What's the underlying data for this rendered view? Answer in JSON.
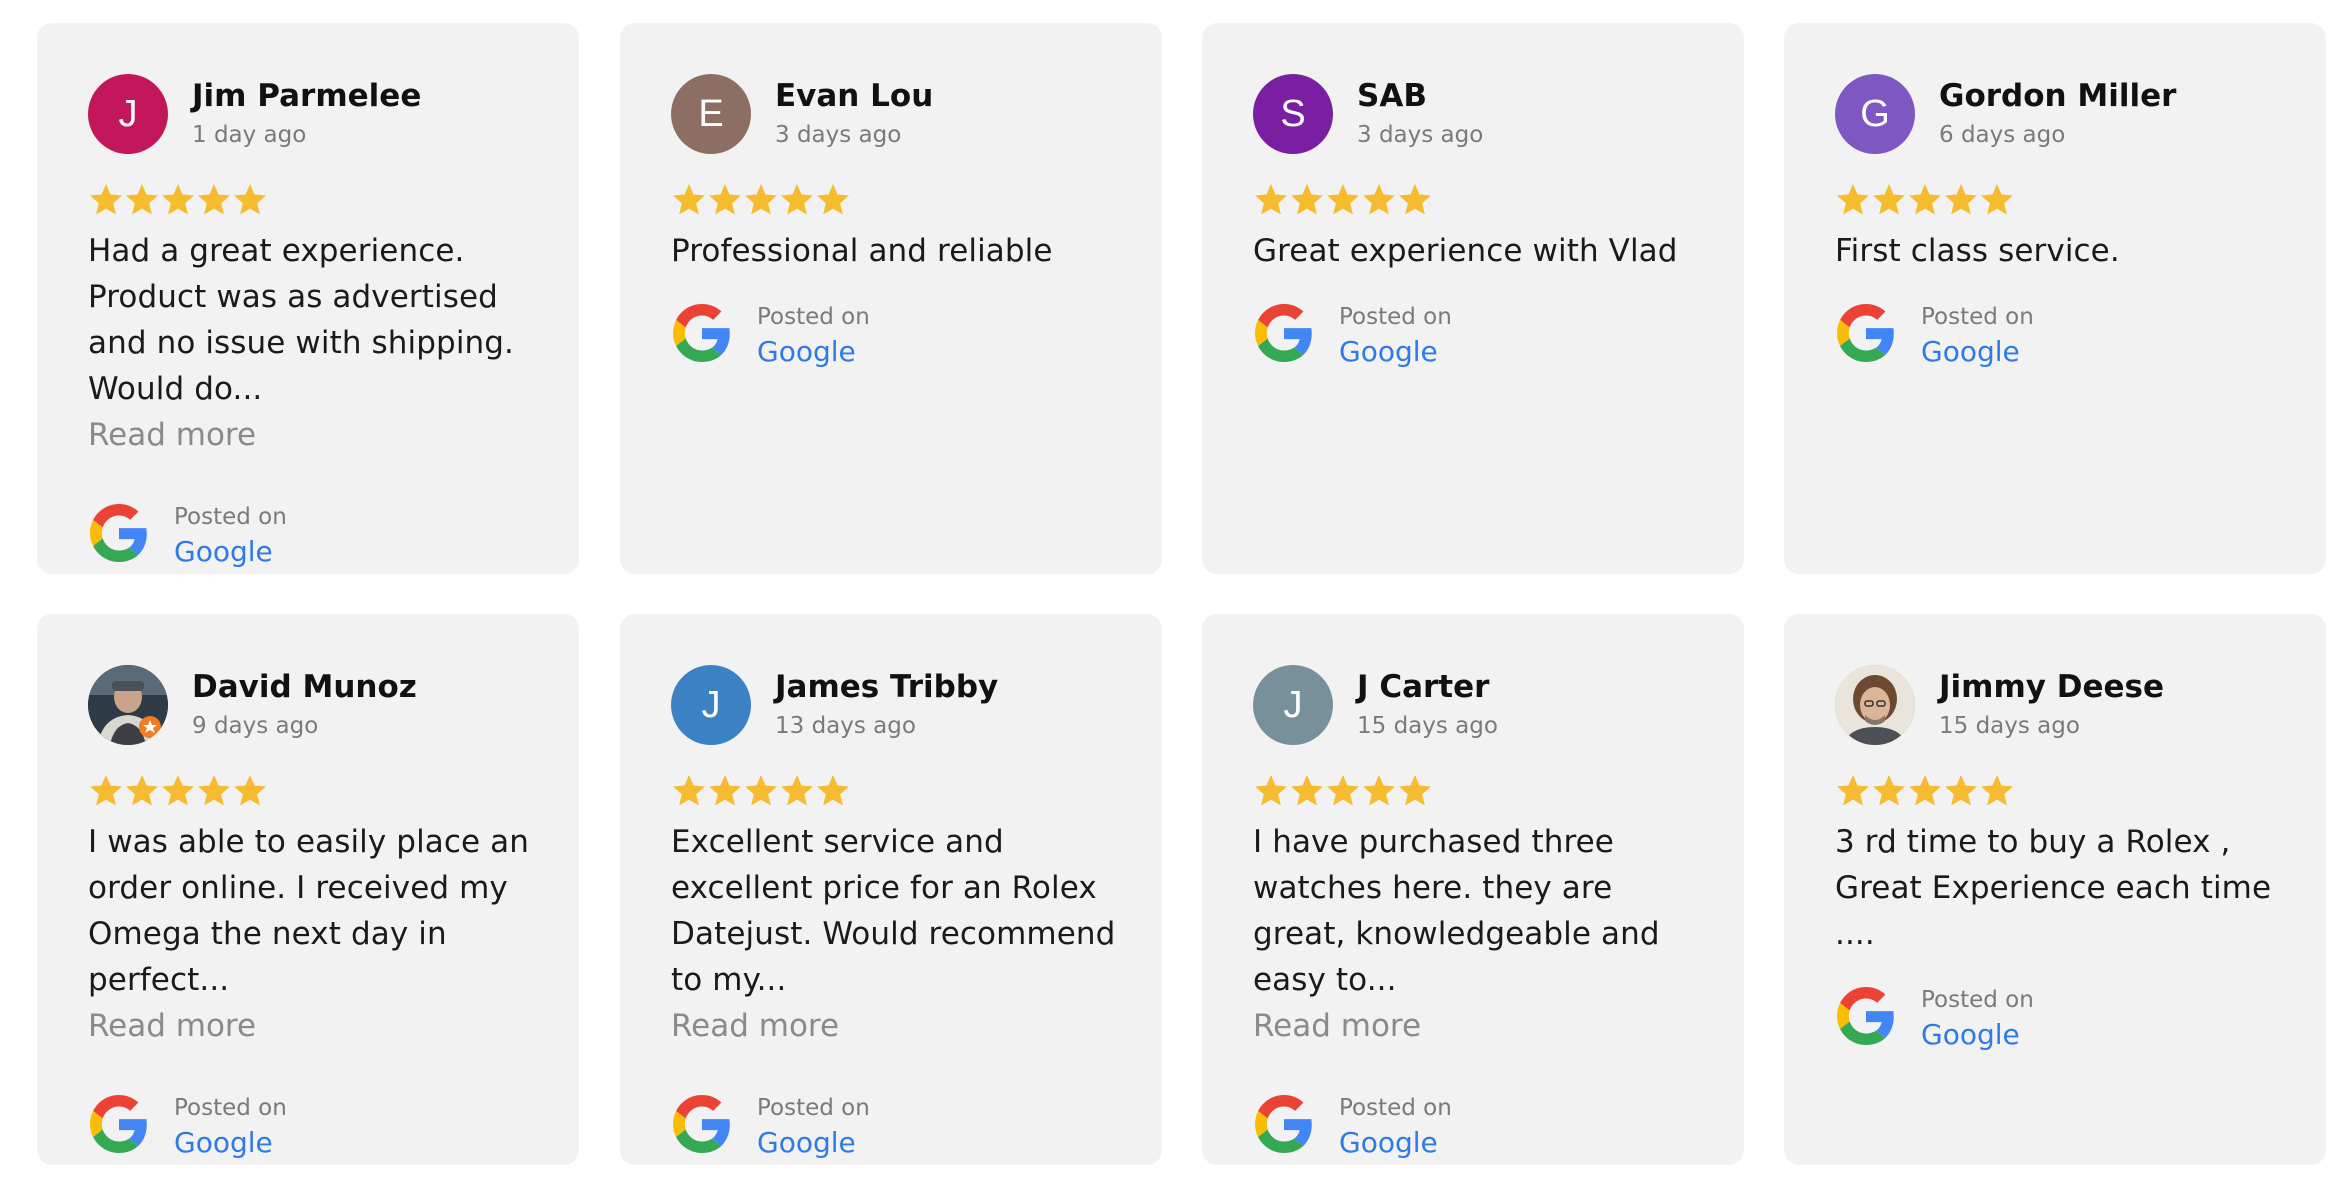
{
  "reviews": [
    {
      "name": "Jim Parmelee",
      "date": "1 day ago",
      "initial": "J",
      "color": "#c2185b",
      "text": "Had a great experience. Product was as advertised and no issue with shipping. Would do...",
      "read_more": "Read more",
      "posted_label": "Posted on",
      "platform": "Google"
    },
    {
      "name": "Evan Lou",
      "date": "3 days ago",
      "initial": "E",
      "color": "#8d6e63",
      "text": "Professional and reliable",
      "posted_label": "Posted on",
      "platform": "Google"
    },
    {
      "name": "SAB",
      "date": "3 days ago",
      "initial": "S",
      "color": "#7b1fa2",
      "text": "Great experience with Vlad",
      "posted_label": "Posted on",
      "platform": "Google"
    },
    {
      "name": "Gordon Miller",
      "date": "6 days ago",
      "initial": "G",
      "color": "#7e57c2",
      "text": "First class service.",
      "posted_label": "Posted on",
      "platform": "Google"
    },
    {
      "name": "David Munoz",
      "date": "9 days ago",
      "initial": "",
      "color": "#3a4a5a",
      "photo": true,
      "text": "I was able to easily place an order online. I received my Omega the next day in perfect...",
      "read_more": "Read more",
      "posted_label": "Posted on",
      "platform": "Google"
    },
    {
      "name": "James Tribby",
      "date": "13 days ago",
      "initial": "J",
      "color": "#3b82c4",
      "text": "Excellent service and excellent price for an Rolex Datejust. Would recommend to my...",
      "read_more": "Read more",
      "posted_label": "Posted on",
      "platform": "Google"
    },
    {
      "name": "J Carter",
      "date": "15 days ago",
      "initial": "J",
      "color": "#78909c",
      "text": "I have purchased three watches here. they are great, knowledgeable and easy to...",
      "read_more": "Read more",
      "posted_label": "Posted on",
      "platform": "Google"
    },
    {
      "name": "Jimmy Deese",
      "date": "15 days ago",
      "initial": "",
      "color": "#b59a7a",
      "photo": true,
      "text": "3 rd time to buy a Rolex , Great Experience each time ....",
      "posted_label": "Posted on",
      "platform": "Google"
    }
  ],
  "rating_stars": 5,
  "star_color": "#f6bb2f",
  "link_color": "#2f7ae5",
  "icons": {
    "platform": "google-icon",
    "rating": "star-icon"
  }
}
